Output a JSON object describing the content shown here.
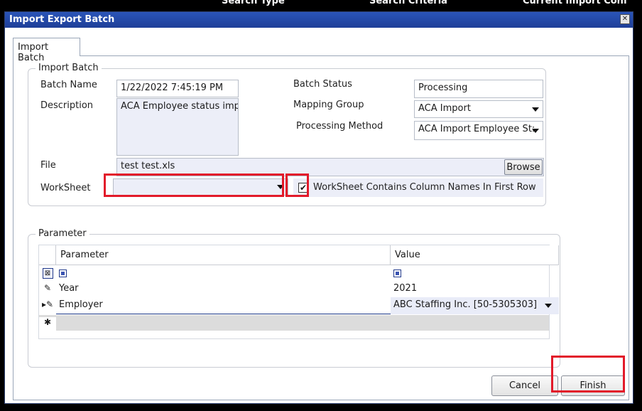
{
  "background": {
    "text_1": "Search Type",
    "text_2": "Search Criteria",
    "text_3": "Current Import Conf"
  },
  "window": {
    "title": "Import Export Batch",
    "close_glyph": "✕"
  },
  "tabs": [
    {
      "label": "Import Batch"
    }
  ],
  "import_batch": {
    "legend": "Import Batch",
    "batch_name_label": "Batch Name",
    "batch_name_value": "1/22/2022 7:45:19 PM",
    "description_label": "Description",
    "description_value": "ACA Employee status import",
    "batch_status_label": "Batch Status",
    "batch_status_value": "Processing",
    "mapping_group_label": "Mapping Group",
    "mapping_group_value": "ACA Import",
    "processing_method_label": "Processing Method",
    "processing_method_value": "ACA Import Employee St:",
    "file_label": "File",
    "file_value": "test test.xls",
    "browse_label": "Browse",
    "worksheet_label": "WorkSheet",
    "worksheet_value": "",
    "column_names_checkbox_label": "WorkSheet Contains Column Names In First Row",
    "column_names_checkbox_glyph": "✔"
  },
  "parameter": {
    "legend": "Parameter",
    "columns": [
      "Parameter",
      "Value"
    ],
    "edit_glyph": "✎",
    "current_glyph": "▸✎",
    "new_row_glyph": "✱",
    "rows": [
      {
        "parameter": "Year",
        "value": "2021"
      },
      {
        "parameter": "Employer",
        "value": "ABC Staffing Inc. [50-5305303]"
      }
    ]
  },
  "footer": {
    "cancel_label": "Cancel",
    "finish_label": "Finish"
  }
}
